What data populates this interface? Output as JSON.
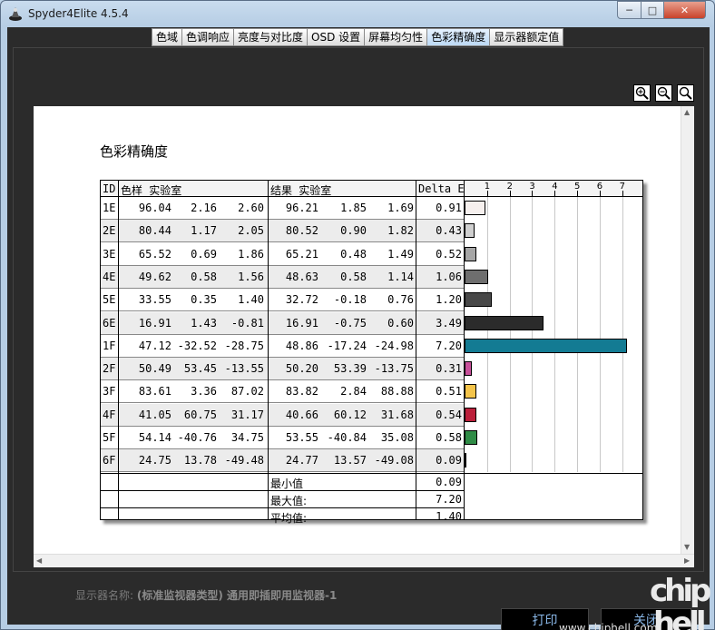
{
  "window": {
    "title": "Spyder4Elite 4.5.4"
  },
  "tabs": [
    {
      "label": "色域",
      "active": false
    },
    {
      "label": "色调响应",
      "active": false
    },
    {
      "label": "亮度与对比度",
      "active": false
    },
    {
      "label": "OSD 设置",
      "active": false
    },
    {
      "label": "屏幕均匀性",
      "active": false
    },
    {
      "label": "色彩精确度",
      "active": true
    },
    {
      "label": "显示器额定值",
      "active": false
    }
  ],
  "report": {
    "title": "色彩精确度",
    "headers": {
      "id": "ID",
      "sample": "色样 实验室",
      "result": "结果 实验室",
      "delta": "Delta E"
    },
    "rows": [
      {
        "id": "1E",
        "s": [
          "96.04",
          "2.16",
          "2.60"
        ],
        "r": [
          "96.21",
          "1.85",
          "1.69"
        ],
        "d": "0.91"
      },
      {
        "id": "2E",
        "s": [
          "80.44",
          "1.17",
          "2.05"
        ],
        "r": [
          "80.52",
          "0.90",
          "1.82"
        ],
        "d": "0.43"
      },
      {
        "id": "3E",
        "s": [
          "65.52",
          "0.69",
          "1.86"
        ],
        "r": [
          "65.21",
          "0.48",
          "1.49"
        ],
        "d": "0.52"
      },
      {
        "id": "4E",
        "s": [
          "49.62",
          "0.58",
          "1.56"
        ],
        "r": [
          "48.63",
          "0.58",
          "1.14"
        ],
        "d": "1.06"
      },
      {
        "id": "5E",
        "s": [
          "33.55",
          "0.35",
          "1.40"
        ],
        "r": [
          "32.72",
          "-0.18",
          "0.76"
        ],
        "d": "1.20"
      },
      {
        "id": "6E",
        "s": [
          "16.91",
          "1.43",
          "-0.81"
        ],
        "r": [
          "16.91",
          "-0.75",
          "0.60"
        ],
        "d": "3.49"
      },
      {
        "id": "1F",
        "s": [
          "47.12",
          "-32.52",
          "-28.75"
        ],
        "r": [
          "48.86",
          "-17.24",
          "-24.98"
        ],
        "d": "7.20"
      },
      {
        "id": "2F",
        "s": [
          "50.49",
          "53.45",
          "-13.55"
        ],
        "r": [
          "50.20",
          "53.39",
          "-13.75"
        ],
        "d": "0.31"
      },
      {
        "id": "3F",
        "s": [
          "83.61",
          "3.36",
          "87.02"
        ],
        "r": [
          "83.82",
          "2.84",
          "88.88"
        ],
        "d": "0.51"
      },
      {
        "id": "4F",
        "s": [
          "41.05",
          "60.75",
          "31.17"
        ],
        "r": [
          "40.66",
          "60.12",
          "31.68"
        ],
        "d": "0.54"
      },
      {
        "id": "5F",
        "s": [
          "54.14",
          "-40.76",
          "34.75"
        ],
        "r": [
          "53.55",
          "-40.84",
          "35.08"
        ],
        "d": "0.58"
      },
      {
        "id": "6F",
        "s": [
          "24.75",
          "13.78",
          "-49.48"
        ],
        "r": [
          "24.77",
          "13.57",
          "-49.08"
        ],
        "d": "0.09"
      }
    ],
    "summary": [
      {
        "label": "最小值",
        "value": "0.09"
      },
      {
        "label": "最大值:",
        "value": "7.20"
      },
      {
        "label": "平均值:",
        "value": "1.40"
      }
    ]
  },
  "chart_data": {
    "type": "bar",
    "orientation": "horizontal",
    "categories": [
      "1E",
      "2E",
      "3E",
      "4E",
      "5E",
      "6E",
      "1F",
      "2F",
      "3F",
      "4F",
      "5F",
      "6F"
    ],
    "values": [
      0.91,
      0.43,
      0.52,
      1.06,
      1.2,
      3.49,
      7.2,
      0.31,
      0.51,
      0.54,
      0.58,
      0.09
    ],
    "colors": [
      "#f6f0ee",
      "#cfcfcf",
      "#a6a6a6",
      "#6e6e6e",
      "#484848",
      "#2b2b2b",
      "#137b93",
      "#c8509a",
      "#f4c44a",
      "#bb1f3a",
      "#2f8c46",
      "#2a3f86"
    ],
    "xticks": [
      "1",
      "2",
      "3",
      "4",
      "5",
      "6",
      "7"
    ],
    "xlim": [
      0,
      8
    ],
    "grid": true
  },
  "footer": {
    "display_name_label": "显示器名称:",
    "display_name_value": "(标准监视器类型) 通用即插即用监视器-1",
    "print_label": "打印",
    "close_label": "关闭",
    "watermark": "www.chiphell.com",
    "logo_text": "chip hell"
  }
}
